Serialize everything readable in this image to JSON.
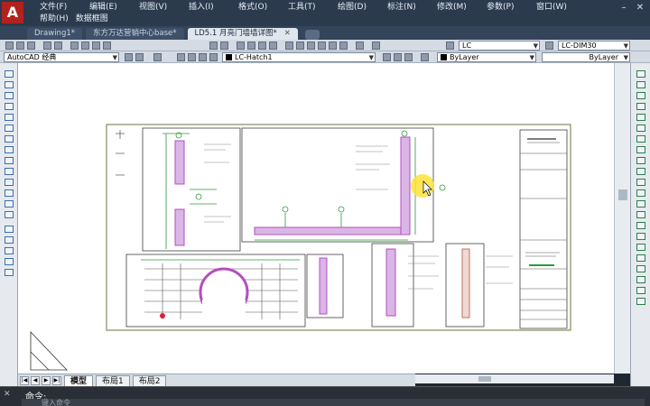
{
  "app": {
    "logo": "A"
  },
  "menu": {
    "row1": [
      "文件(F)",
      "编辑(E)",
      "视图(V)",
      "插入(I)",
      "格式(O)",
      "工具(T)",
      "绘图(D)",
      "标注(N)",
      "修改(M)",
      "参数(P)",
      "窗口(W)"
    ],
    "row2": [
      "帮助(H)",
      "数据框图"
    ]
  },
  "doc_tabs": [
    {
      "label": "Drawing1*",
      "active": false
    },
    {
      "label": "东方万达营销中心base*",
      "active": false
    },
    {
      "label": "LD5.1 月亮门墙墙详图*",
      "active": true,
      "close": "✕"
    }
  ],
  "toolbar1": {
    "textstyle_combo": "LC",
    "dimstyle_combo": "LC-DIM30"
  },
  "toolbar2": {
    "workspace_combo": "AutoCAD 经典",
    "layer_combo": "LC-Hatch1",
    "color_combo": "ByLayer",
    "linetype_combo": "ByLayer"
  },
  "layout_tabs": [
    {
      "label": "模型",
      "active": true
    },
    {
      "label": "布局1",
      "active": false
    },
    {
      "label": "布局2",
      "active": false
    }
  ],
  "command": {
    "label": "命令:",
    "placeholder": "键入命令"
  },
  "colors": {
    "accent_green": "#2c9a3a",
    "hatch_magenta": "#b44fc0",
    "cursor_highlight": "#ffe23a"
  }
}
